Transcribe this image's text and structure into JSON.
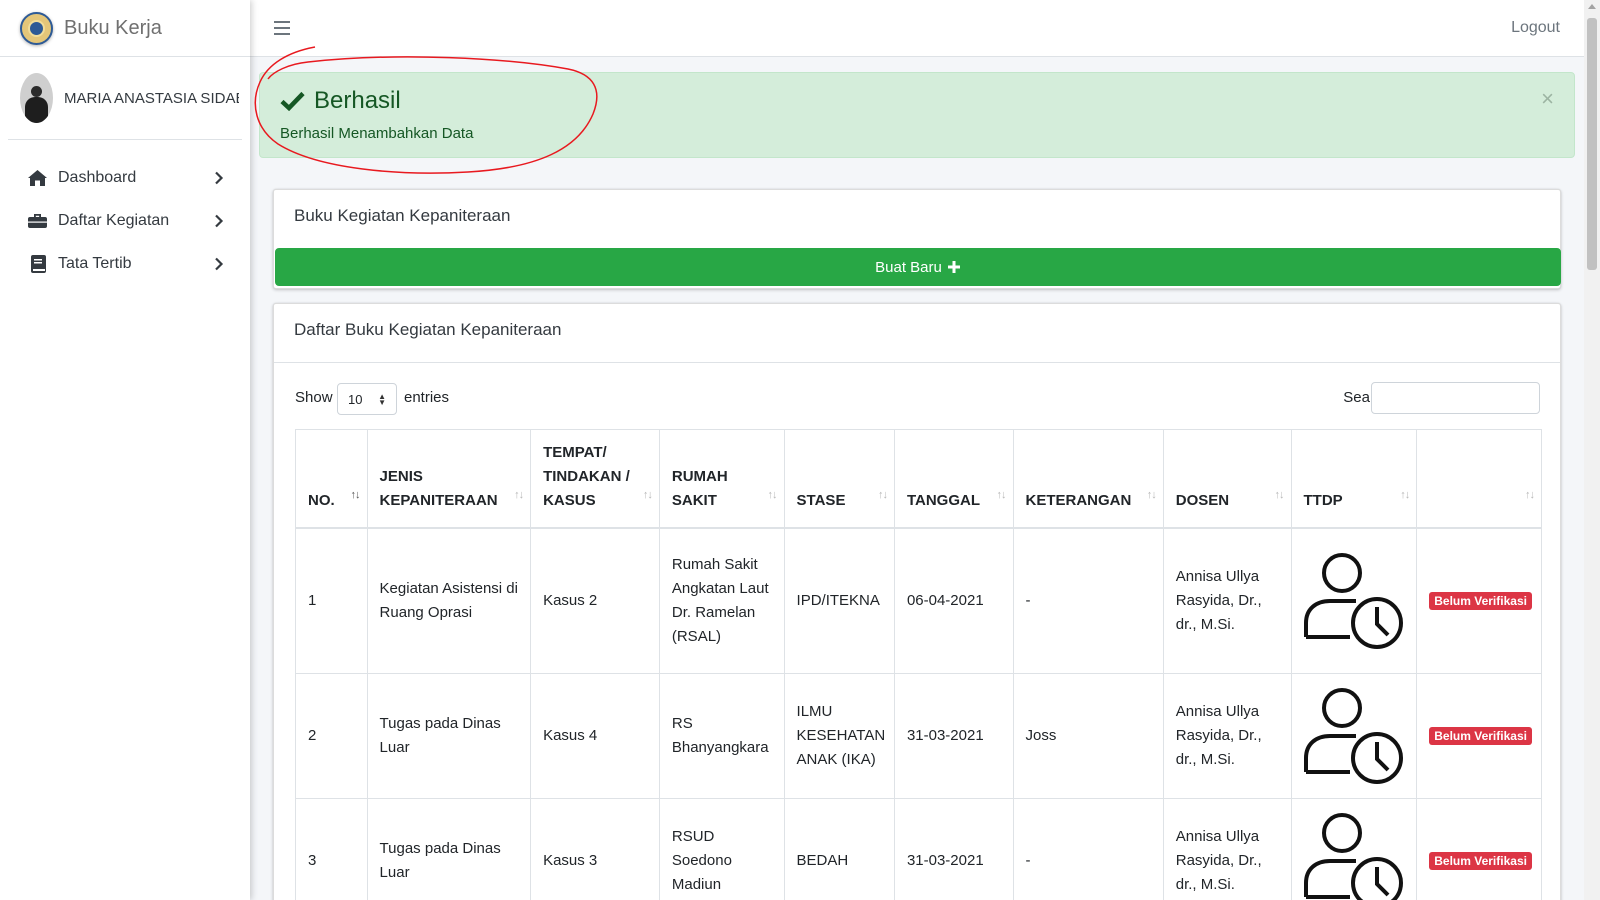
{
  "app": {
    "brand": "Buku Kerja"
  },
  "user": {
    "name": "MARIA ANASTASIA SIDABUTAR"
  },
  "sidebar": {
    "items": [
      {
        "label": "Dashboard",
        "icon": "home-icon"
      },
      {
        "label": "Daftar Kegiatan",
        "icon": "briefcase-icon"
      },
      {
        "label": "Tata Tertib",
        "icon": "book-icon"
      }
    ]
  },
  "topbar": {
    "logout": "Logout"
  },
  "alert": {
    "title": "Berhasil",
    "message": "Berhasil Menambahkan Data",
    "close": "×",
    "color": "#d4edda"
  },
  "card1": {
    "title": "Buku Kegiatan Kepaniteraan",
    "button": "Buat Baru"
  },
  "card2": {
    "title": "Daftar Buku Kegiatan Kepaniteraan",
    "show": "Show",
    "entries_value": "10",
    "entries": "entries",
    "search_label": "Search:"
  },
  "table": {
    "headers": [
      "NO.",
      "JENIS KEPANITERAAN",
      "TEMPAT/ TINDAKAN / KASUS",
      "RUMAH SAKIT",
      "STASE",
      "TANGGAL",
      "KETERANGAN",
      "DOSEN",
      "TTDP",
      ""
    ],
    "rows": [
      {
        "no": "1",
        "jenis": "Kegiatan Asistensi di Ruang Oprasi",
        "tempat": "Kasus 2",
        "rs": "Rumah Sakit Angkatan Laut Dr. Ramelan (RSAL)",
        "stase": "IPD/ITEKNA",
        "tanggal": "06-04-2021",
        "keterangan": "-",
        "dosen": "Annisa Ullya Rasyida, Dr., dr., M.Si.",
        "status": "Belum Verifikasi"
      },
      {
        "no": "2",
        "jenis": "Tugas pada Dinas Luar",
        "tempat": "Kasus 4",
        "rs": "RS Bhanyangkara",
        "stase": "ILMU KESEHATAN ANAK (IKA)",
        "tanggal": "31-03-2021",
        "keterangan": "Joss",
        "dosen": "Annisa Ullya Rasyida, Dr., dr., M.Si.",
        "status": "Belum Verifikasi"
      },
      {
        "no": "3",
        "jenis": "Tugas pada Dinas Luar",
        "tempat": "Kasus 3",
        "rs": "RSUD Soedono Madiun",
        "stase": "BEDAH",
        "tanggal": "31-03-2021",
        "keterangan": "-",
        "dosen": "Annisa Ullya Rasyida, Dr., dr., M.Si.",
        "status": "Belum Verifikasi"
      }
    ]
  },
  "colors": {
    "success": "#28a745",
    "danger": "#dc3545",
    "annotation": "#e8191f"
  }
}
